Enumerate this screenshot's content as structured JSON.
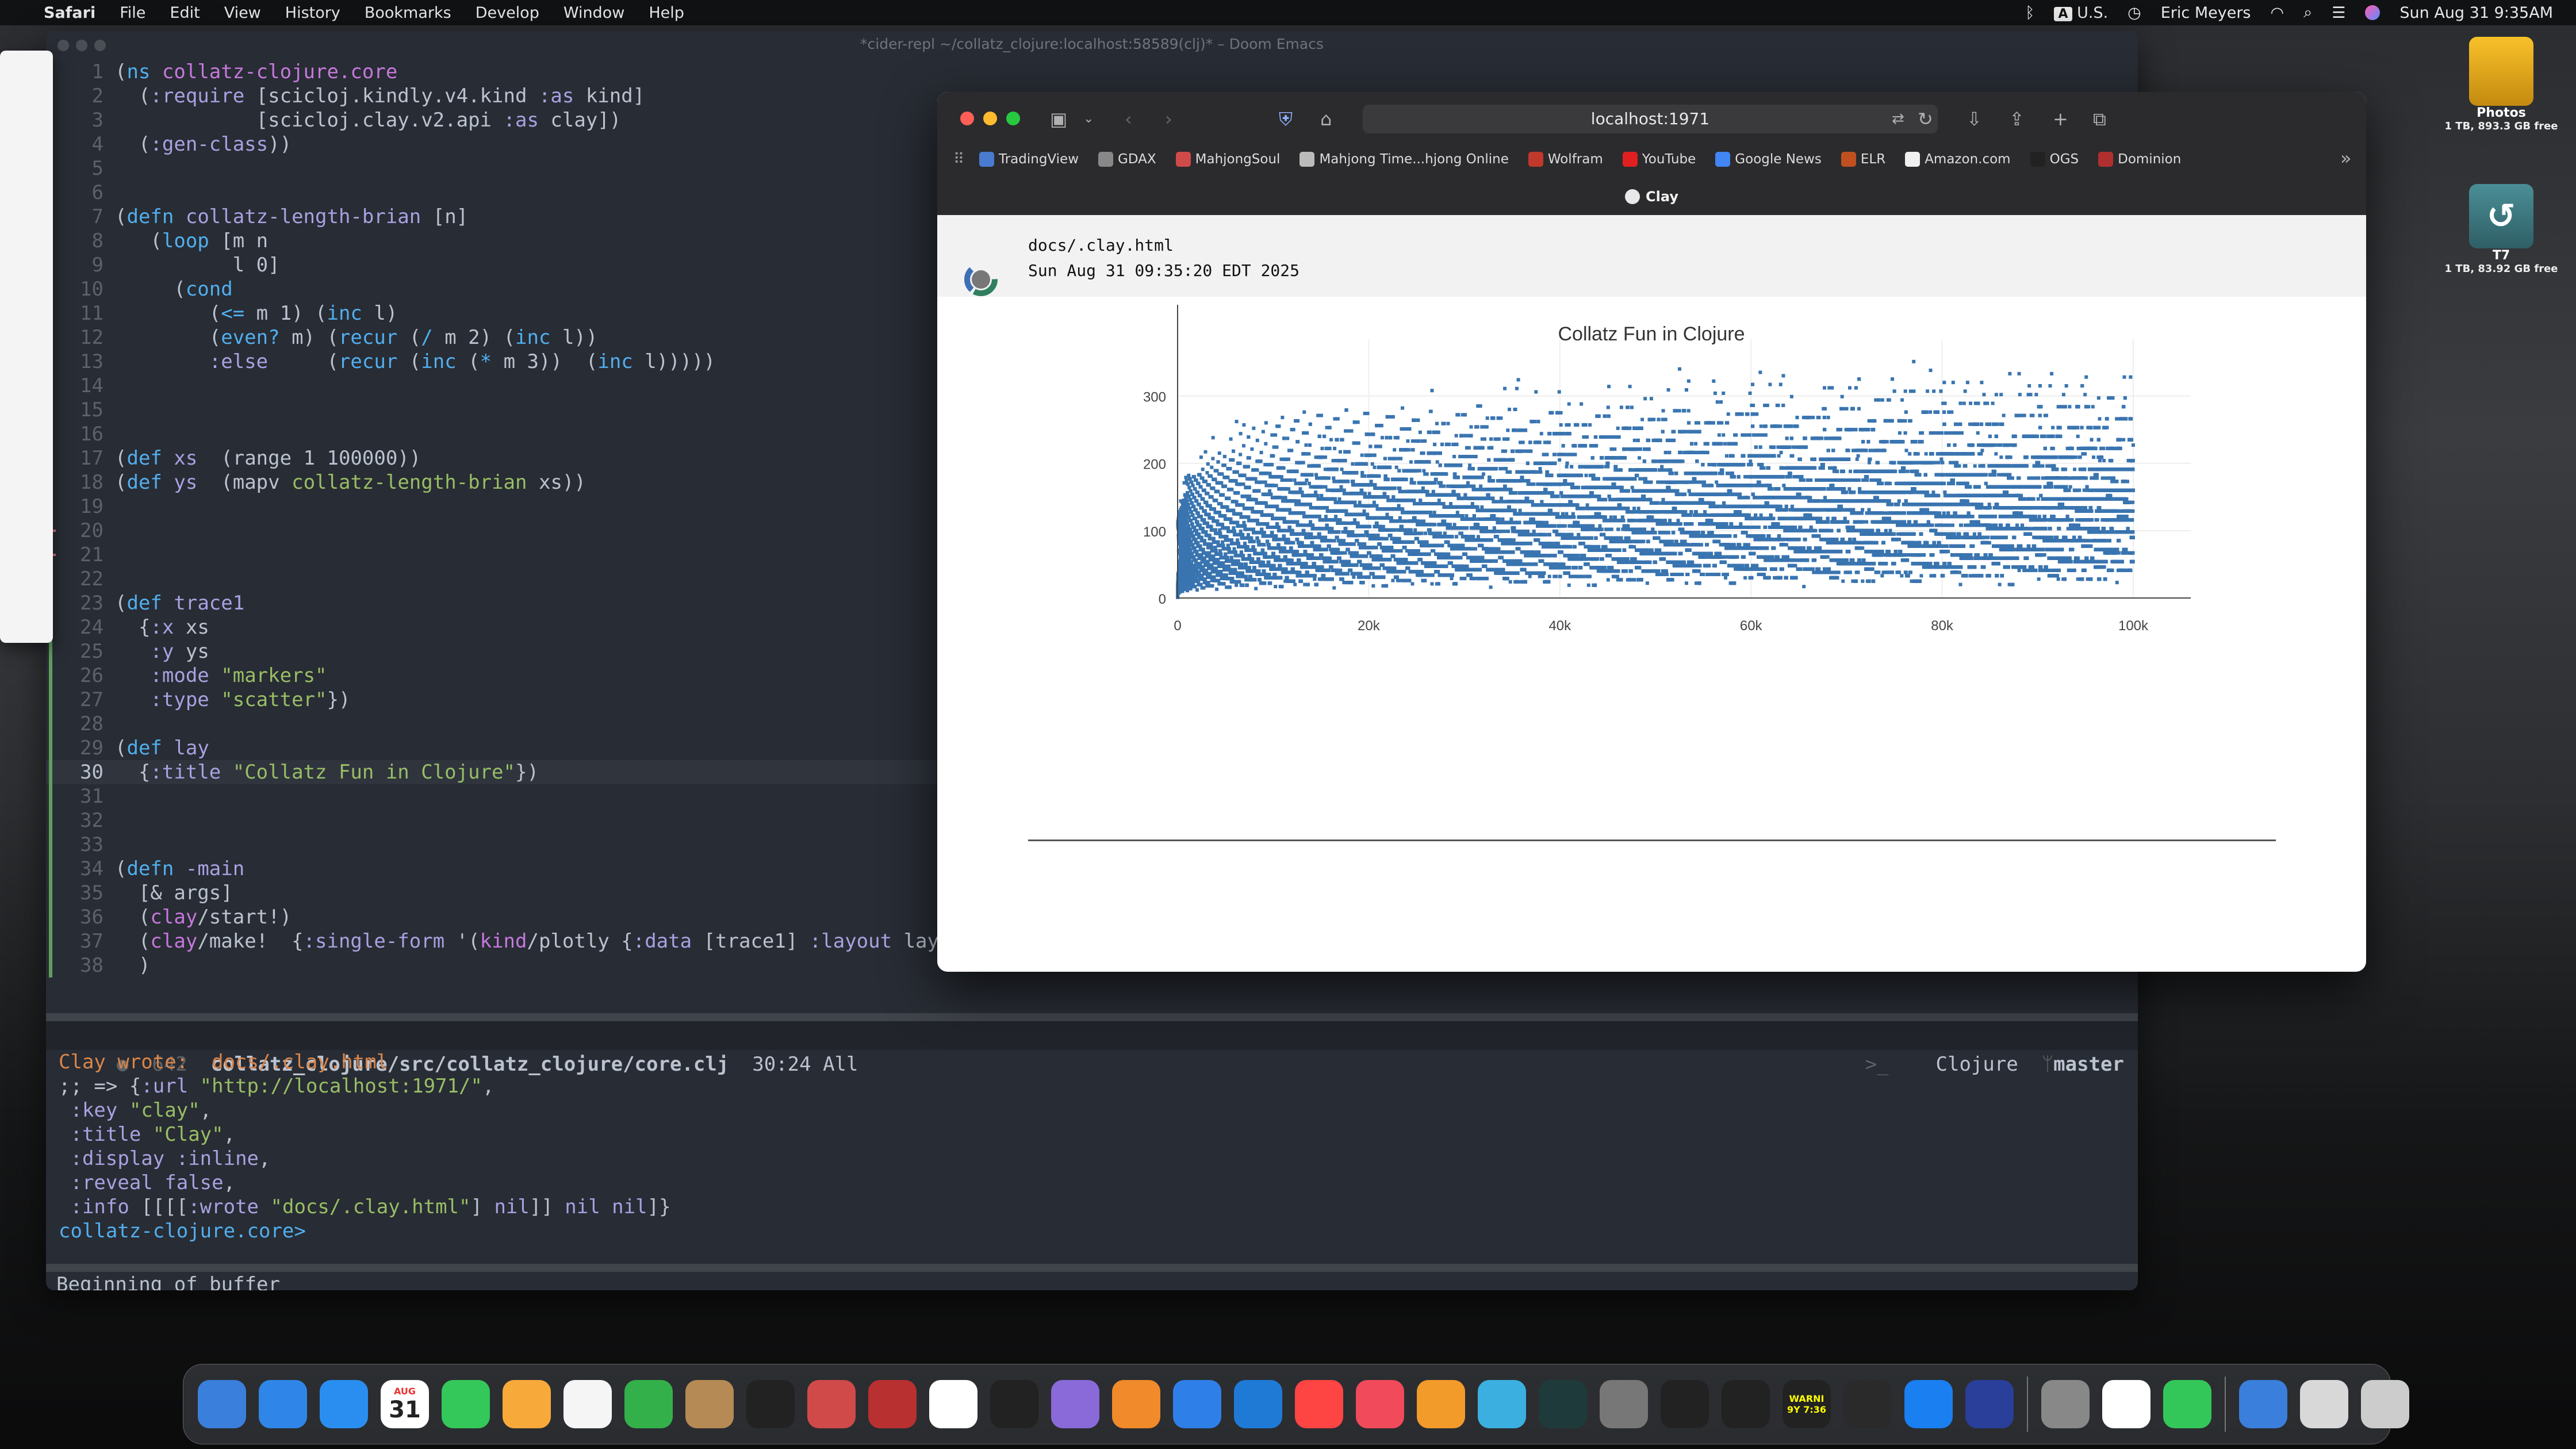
{
  "menubar": {
    "app": "Safari",
    "items": [
      "File",
      "Edit",
      "View",
      "History",
      "Bookmarks",
      "Develop",
      "Window",
      "Help"
    ],
    "input_source": "U.S.",
    "input_badge": "A",
    "user": "Eric Meyers",
    "datetime": "Sun Aug 31  9:35AM"
  },
  "emacs": {
    "title": "*cider-repl ~/collatz_clojure:localhost:58589(clj)* – Doom Emacs",
    "code_lines": [
      [
        {
          "t": "(",
          "c": "paren"
        },
        {
          "t": "ns ",
          "c": "kw"
        },
        {
          "t": "collatz-clojure.core",
          "c": "fn"
        }
      ],
      [
        {
          "t": "  (",
          "c": "paren"
        },
        {
          "t": ":require ",
          "c": "kwd"
        },
        {
          "t": "[scicloj.kindly.v4.kind ",
          "c": "plain"
        },
        {
          "t": ":as ",
          "c": "kwd"
        },
        {
          "t": "kind]",
          "c": "plain"
        }
      ],
      [
        {
          "t": "            [scicloj.clay.v2.api ",
          "c": "plain"
        },
        {
          "t": ":as ",
          "c": "kwd"
        },
        {
          "t": "clay])",
          "c": "plain"
        }
      ],
      [
        {
          "t": "  (",
          "c": "paren"
        },
        {
          "t": ":gen-class",
          "c": "kwd"
        },
        {
          "t": "))",
          "c": "paren"
        }
      ],
      [],
      [],
      [
        {
          "t": "(",
          "c": "paren"
        },
        {
          "t": "defn ",
          "c": "kw"
        },
        {
          "t": "collatz-length-brian ",
          "c": "name"
        },
        {
          "t": "[n]",
          "c": "plain"
        }
      ],
      [
        {
          "t": "   (",
          "c": "paren"
        },
        {
          "t": "loop ",
          "c": "kw"
        },
        {
          "t": "[m n",
          "c": "plain"
        }
      ],
      [
        {
          "t": "          l 0]",
          "c": "plain"
        }
      ],
      [
        {
          "t": "     (",
          "c": "paren"
        },
        {
          "t": "cond",
          "c": "kw"
        }
      ],
      [
        {
          "t": "        (",
          "c": "paren"
        },
        {
          "t": "<= ",
          "c": "kw"
        },
        {
          "t": "m 1) (",
          "c": "plain"
        },
        {
          "t": "inc ",
          "c": "kw"
        },
        {
          "t": "l)",
          "c": "plain"
        }
      ],
      [
        {
          "t": "        (",
          "c": "paren"
        },
        {
          "t": "even? ",
          "c": "kw"
        },
        {
          "t": "m) (",
          "c": "plain"
        },
        {
          "t": "recur ",
          "c": "kw"
        },
        {
          "t": "(",
          "c": "plain"
        },
        {
          "t": "/ ",
          "c": "kw"
        },
        {
          "t": "m 2) (",
          "c": "plain"
        },
        {
          "t": "inc ",
          "c": "kw"
        },
        {
          "t": "l))",
          "c": "plain"
        }
      ],
      [
        {
          "t": "        ",
          "c": "plain"
        },
        {
          "t": ":else",
          "c": "kwd"
        },
        {
          "t": "     (",
          "c": "plain"
        },
        {
          "t": "recur ",
          "c": "kw"
        },
        {
          "t": "(",
          "c": "plain"
        },
        {
          "t": "inc ",
          "c": "kw"
        },
        {
          "t": "(",
          "c": "plain"
        },
        {
          "t": "* ",
          "c": "kw"
        },
        {
          "t": "m 3))  (",
          "c": "plain"
        },
        {
          "t": "inc ",
          "c": "kw"
        },
        {
          "t": "l)))))",
          "c": "plain"
        }
      ],
      [],
      [],
      [],
      [
        {
          "t": "(",
          "c": "paren"
        },
        {
          "t": "def ",
          "c": "kw"
        },
        {
          "t": "xs  ",
          "c": "name"
        },
        {
          "t": "(range 1 100000))",
          "c": "plain"
        }
      ],
      [
        {
          "t": "(",
          "c": "paren"
        },
        {
          "t": "def ",
          "c": "kw"
        },
        {
          "t": "ys  ",
          "c": "name"
        },
        {
          "t": "(mapv ",
          "c": "plain"
        },
        {
          "t": "collatz-length-brian ",
          "c": "str"
        },
        {
          "t": "xs))",
          "c": "plain"
        }
      ],
      [],
      [],
      [],
      [],
      [
        {
          "t": "(",
          "c": "paren"
        },
        {
          "t": "def ",
          "c": "kw"
        },
        {
          "t": "trace1",
          "c": "name"
        }
      ],
      [
        {
          "t": "  {",
          "c": "paren"
        },
        {
          "t": ":x ",
          "c": "kwd"
        },
        {
          "t": "xs",
          "c": "plain"
        }
      ],
      [
        {
          "t": "   ",
          "c": "plain"
        },
        {
          "t": ":y ",
          "c": "kwd"
        },
        {
          "t": "ys",
          "c": "plain"
        }
      ],
      [
        {
          "t": "   ",
          "c": "plain"
        },
        {
          "t": ":mode ",
          "c": "kwd"
        },
        {
          "t": "\"markers\"",
          "c": "str"
        }
      ],
      [
        {
          "t": "   ",
          "c": "plain"
        },
        {
          "t": ":type ",
          "c": "kwd"
        },
        {
          "t": "\"scatter\"",
          "c": "str"
        },
        {
          "t": "})",
          "c": "plain"
        }
      ],
      [],
      [
        {
          "t": "(",
          "c": "paren"
        },
        {
          "t": "def ",
          "c": "kw"
        },
        {
          "t": "lay",
          "c": "name"
        }
      ],
      [
        {
          "t": "  {",
          "c": "paren"
        },
        {
          "t": ":title ",
          "c": "kwd"
        },
        {
          "t": "\"Collatz Fun in Clojure\"",
          "c": "str"
        },
        {
          "t": "})",
          "c": "plain"
        }
      ],
      [],
      [],
      [],
      [
        {
          "t": "(",
          "c": "paren"
        },
        {
          "t": "defn ",
          "c": "kw"
        },
        {
          "t": "-main",
          "c": "name"
        }
      ],
      [
        {
          "t": "  [& args]",
          "c": "plain"
        }
      ],
      [
        {
          "t": "  (",
          "c": "paren"
        },
        {
          "t": "clay",
          "c": "fn"
        },
        {
          "t": "/start!)",
          "c": "plain"
        }
      ],
      [
        {
          "t": "  (",
          "c": "paren"
        },
        {
          "t": "clay",
          "c": "fn"
        },
        {
          "t": "/make!  {",
          "c": "plain"
        },
        {
          "t": ":single-form ",
          "c": "kwd"
        },
        {
          "t": "'(",
          "c": "plain"
        },
        {
          "t": "kind",
          "c": "fn"
        },
        {
          "t": "/plotly {",
          "c": "plain"
        },
        {
          "t": ":data ",
          "c": "kwd"
        },
        {
          "t": "[trace1] ",
          "c": "plain"
        },
        {
          "t": ":layout ",
          "c": "kwd"
        },
        {
          "t": "lay}",
          "c": "plain"
        }
      ],
      [
        {
          "t": "  )",
          "c": "paren"
        }
      ]
    ],
    "modeline": {
      "count": "642",
      "path": "collatz_clojure/src/collatz_clojure/core.clj",
      "position": "30:24 All",
      "prompt": ">_",
      "mode": "Clojure",
      "branch": "master"
    },
    "repl_lines": [
      [
        {
          "t": "Clay wrote:  docs/.clay.html",
          "c": "num"
        }
      ],
      [
        {
          "t": ";; => {",
          "c": "plain"
        },
        {
          "t": ":url ",
          "c": "kwd"
        },
        {
          "t": "\"http://localhost:1971/\"",
          "c": "str"
        },
        {
          "t": ",",
          "c": "plain"
        }
      ],
      [
        {
          "t": " ",
          "c": "plain"
        },
        {
          "t": ":key ",
          "c": "kwd"
        },
        {
          "t": "\"clay\"",
          "c": "str"
        },
        {
          "t": ",",
          "c": "plain"
        }
      ],
      [
        {
          "t": " ",
          "c": "plain"
        },
        {
          "t": ":title ",
          "c": "kwd"
        },
        {
          "t": "\"Clay\"",
          "c": "str"
        },
        {
          "t": ",",
          "c": "plain"
        }
      ],
      [
        {
          "t": " ",
          "c": "plain"
        },
        {
          "t": ":display ",
          "c": "kwd"
        },
        {
          "t": ":inline",
          "c": "kwd"
        },
        {
          "t": ",",
          "c": "plain"
        }
      ],
      [
        {
          "t": " ",
          "c": "plain"
        },
        {
          "t": ":reveal ",
          "c": "kwd"
        },
        {
          "t": "false",
          "c": "kwd"
        },
        {
          "t": ",",
          "c": "plain"
        }
      ],
      [
        {
          "t": " ",
          "c": "plain"
        },
        {
          "t": ":info ",
          "c": "kwd"
        },
        {
          "t": "[[[[",
          "c": "plain"
        },
        {
          "t": ":wrote ",
          "c": "kwd"
        },
        {
          "t": "\"docs/.clay.html\"",
          "c": "str"
        },
        {
          "t": "] ",
          "c": "plain"
        },
        {
          "t": "nil",
          "c": "kwd"
        },
        {
          "t": "]] ",
          "c": "plain"
        },
        {
          "t": "nil nil",
          "c": "kwd"
        },
        {
          "t": "]}",
          "c": "plain"
        }
      ],
      [
        {
          "t": "collatz-clojure.core>",
          "c": "kw"
        }
      ]
    ],
    "minibuffer": "Beginning of buffer"
  },
  "safari": {
    "url": "localhost:1971",
    "bookmarks": [
      "TradingView",
      "GDAX",
      "MahjongSoul",
      "Mahjong Time...hjong Online",
      "Wolfram",
      "YouTube",
      "Google News",
      "ELR",
      "Amazon.com",
      "OGS",
      "Dominion"
    ],
    "tab": "Clay",
    "page": {
      "file": "docs/.clay.html",
      "timestamp": "Sun Aug 31 09:35:20 EDT 2025"
    }
  },
  "chart_data": {
    "type": "scatter",
    "title": "Collatz Fun in Clojure",
    "xlabel": "",
    "ylabel": "",
    "xlim": [
      0,
      100000
    ],
    "ylim": [
      0,
      350
    ],
    "x_ticks": [
      0,
      20000,
      40000,
      60000,
      80000,
      100000
    ],
    "x_tick_labels": [
      "0",
      "20k",
      "40k",
      "60k",
      "80k",
      "100k"
    ],
    "y_ticks": [
      0,
      100,
      200,
      300
    ],
    "y_tick_labels": [
      "0",
      "100",
      "200",
      "300"
    ],
    "marker_color": "#3a75b0",
    "grid": true,
    "series": [
      {
        "x": [
          1,
          27,
          97,
          871,
          6171,
          10971,
          13255,
          17647,
          23529,
          26623,
          34239,
          35655,
          52527,
          77031,
          5000,
          15000,
          25000,
          35000,
          45000,
          55000,
          65000,
          75000,
          85000,
          95000,
          2000,
          8000,
          30000,
          50000,
          70000,
          90000,
          99999
        ],
        "y": [
          1,
          112,
          119,
          179,
          262,
          268,
          276,
          279,
          282,
          308,
          311,
          324,
          340,
          351,
          30,
          50,
          65,
          80,
          100,
          120,
          140,
          160,
          180,
          200,
          180,
          210,
          240,
          250,
          270,
          290,
          227
        ]
      }
    ]
  },
  "desktop": {
    "icons": [
      {
        "label": "Photos",
        "sub": "1 TB, 893.3 GB free"
      },
      {
        "label": "T7",
        "sub": "1 TB, 83.92 GB free"
      }
    ]
  },
  "dock": {
    "apps": [
      "finder-icon",
      "safari-icon",
      "mail-icon",
      "calendar-icon",
      "messages-icon",
      "pages-icon",
      "photos-icon",
      "numbers-icon",
      "contacts-icon",
      "claude-icon",
      "lichess-icon",
      "prompt-icon",
      "arc-icon",
      "emacs-icon",
      "dictionary-icon",
      "xcode-icon",
      "vscode-icon",
      "news-icon",
      "music-icon",
      "books-icon",
      "maps-icon",
      "timemachine-icon",
      "settings-icon",
      "activity-icon",
      "terminal-icon",
      "iterm-icon",
      "console-icon",
      "appstore-icon",
      "bitwarden-icon",
      "preview-icon",
      "chrome-icon",
      "facetime-icon",
      "screenshare-icon",
      "files-icon",
      "printer-icon",
      "trash-icon"
    ],
    "calendar_month": "AUG",
    "calendar_day": "31",
    "console_text": "WARNI\n9Y 7:36"
  }
}
